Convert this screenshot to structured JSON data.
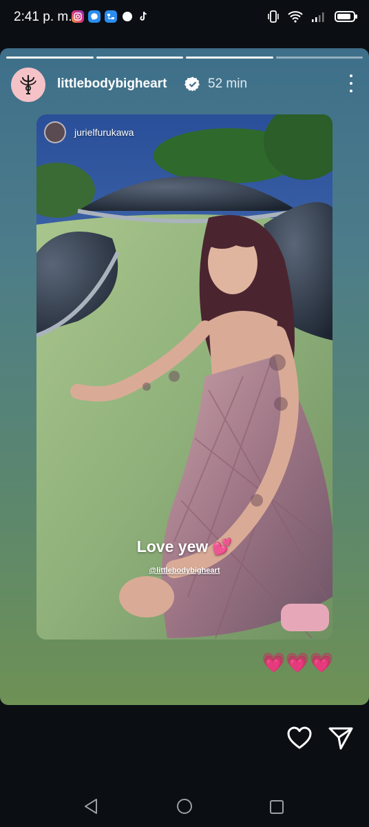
{
  "status_bar": {
    "time": "2:41 p. m.",
    "notification_icons": [
      "instagram-icon",
      "messenger-icon",
      "vpn-icon",
      "dot-icon",
      "tiktok-icon"
    ],
    "system_icons": [
      "vibrate-icon",
      "wifi-icon",
      "signal-icon",
      "battery-icon"
    ]
  },
  "story": {
    "progress_segments": 4,
    "progress_done": 3,
    "username": "littlebodybigheart",
    "verified": true,
    "time_ago": "52 min",
    "background_top": "#3e6f8a",
    "background_bottom": "#6e9155"
  },
  "shared_post": {
    "author": "jurielfurukawa",
    "caption": "Love yew 💕",
    "mention": "@littlebodybigheart"
  },
  "stickers": {
    "hearts": "💗💗💗"
  },
  "actions": {
    "like": "heart-icon",
    "share": "send-icon"
  },
  "navigation": {
    "back": "back-triangle-icon",
    "home": "home-circle-icon",
    "recents": "recents-square-icon"
  }
}
